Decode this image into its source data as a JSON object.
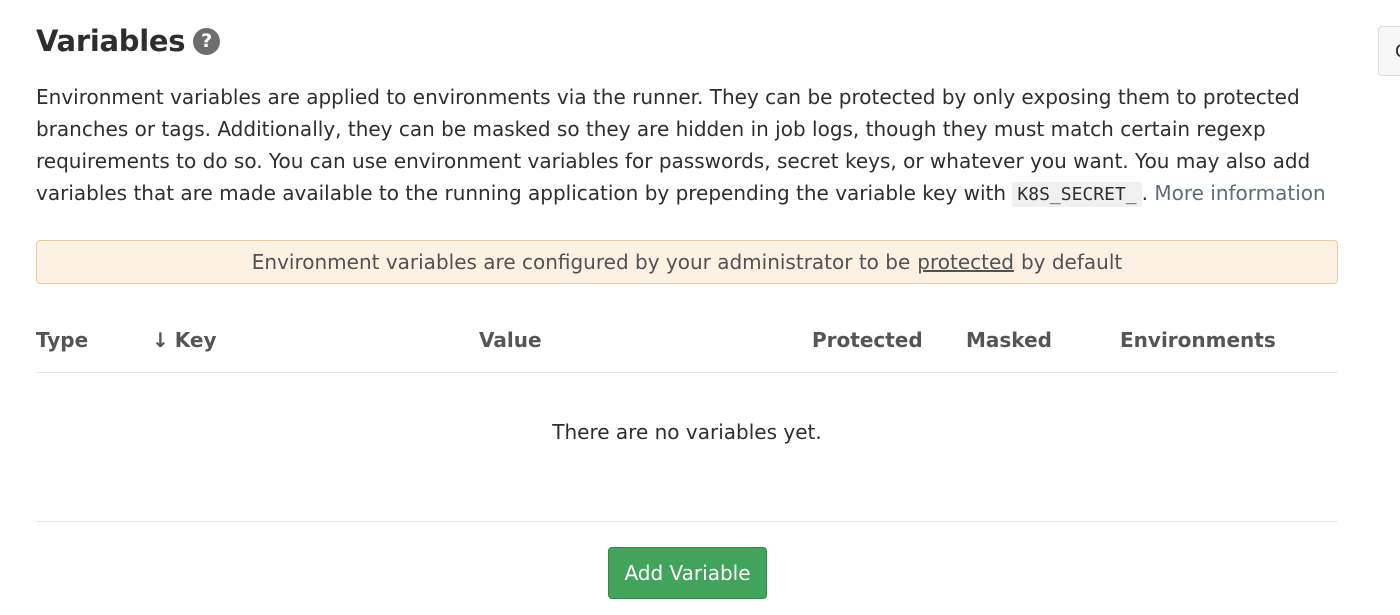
{
  "section": {
    "title": "Variables",
    "help_icon": "question-circle-icon",
    "description_text": "Environment variables are applied to environments via the runner. They can be protected by only exposing them to protected branches or tags. Additionally, they can be masked so they are hidden in job logs, though they must match certain regexp requirements to do so. You can use environment variables for passwords, secret keys, or whatever you want. You may also add variables that are made available to the running application by prepending the variable key with",
    "code_prefix": "K8S_SECRET_",
    "description_period": ".",
    "more_info_link": "More information"
  },
  "alert": {
    "text_before": "Environment variables are configured by your administrator to be",
    "link": "protected",
    "text_after": "by default"
  },
  "table": {
    "columns": {
      "type": "Type",
      "key": "Key",
      "value": "Value",
      "protected": "Protected",
      "masked": "Masked",
      "environments": "Environments"
    },
    "sort_icon": "arrow-down-icon",
    "empty_message": "There are no variables yet."
  },
  "actions": {
    "add_variable": "Add Variable",
    "edge_button": "C"
  },
  "colors": {
    "add_button_bg": "#42a35a",
    "alert_bg": "#fdf1e4",
    "alert_border": "#ebc99c"
  }
}
